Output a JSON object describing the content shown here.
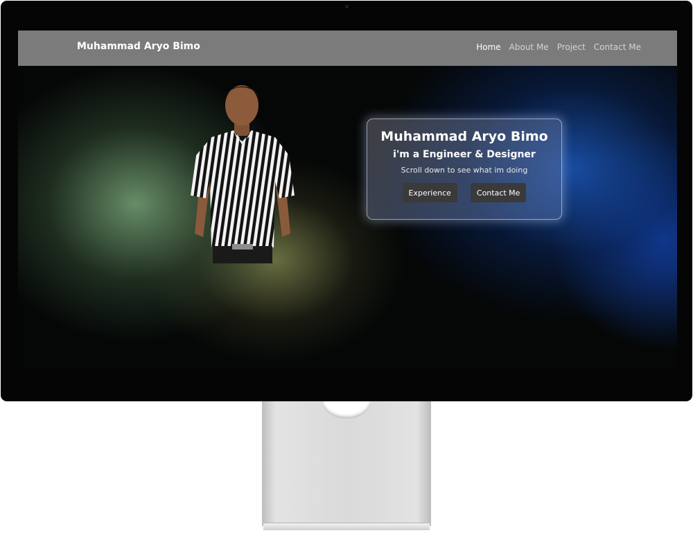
{
  "navbar": {
    "brand": "Muhammad Aryo Bimo",
    "links": [
      {
        "label": "Home",
        "active": true
      },
      {
        "label": "About Me",
        "active": false
      },
      {
        "label": "Project",
        "active": false
      },
      {
        "label": "Contact Me",
        "active": false
      }
    ]
  },
  "hero": {
    "name": "Muhammad Aryo Bimo",
    "role": "i'm a Engineer & Designer",
    "subtitle": "Scroll down to see what im doing",
    "buttons": {
      "experience": "Experience",
      "contact": "Contact Me"
    }
  },
  "colors": {
    "navbar_bg": "#7b7b7b",
    "button_bg": "#3a3a3a",
    "monitor_frame": "#050505"
  },
  "icons": {
    "photo": "person-portrait"
  }
}
